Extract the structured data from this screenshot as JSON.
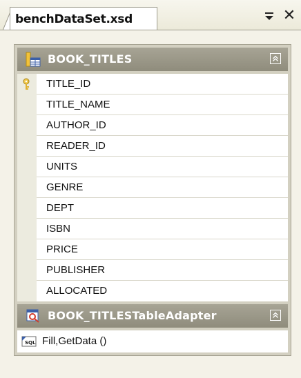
{
  "tab": {
    "title": "benchDataSet.xsd"
  },
  "table": {
    "name": "BOOK_TITLES",
    "columns": [
      "TITLE_ID",
      "TITLE_NAME",
      "AUTHOR_ID",
      "READER_ID",
      "UNITS",
      "GENRE",
      "DEPT",
      "ISBN",
      "PRICE",
      "PUBLISHER",
      "ALLOCATED"
    ],
    "key_column": "TITLE_ID"
  },
  "adapter": {
    "name": "BOOK_TITLESTableAdapter",
    "queries": [
      "Fill,GetData ()"
    ]
  },
  "icons": {
    "tab_menu": "dropdown-pin-icon",
    "tab_close": "close-icon",
    "table": "datatable-icon",
    "key": "primary-key-icon",
    "adapter": "tableadapter-icon",
    "sql": "sql-query-icon",
    "collapse": "collapse-chevron-icon"
  },
  "colors": {
    "header_bg": "#9b9888",
    "header_text": "#ffffff",
    "canvas_bg": "#f4f2e8"
  }
}
